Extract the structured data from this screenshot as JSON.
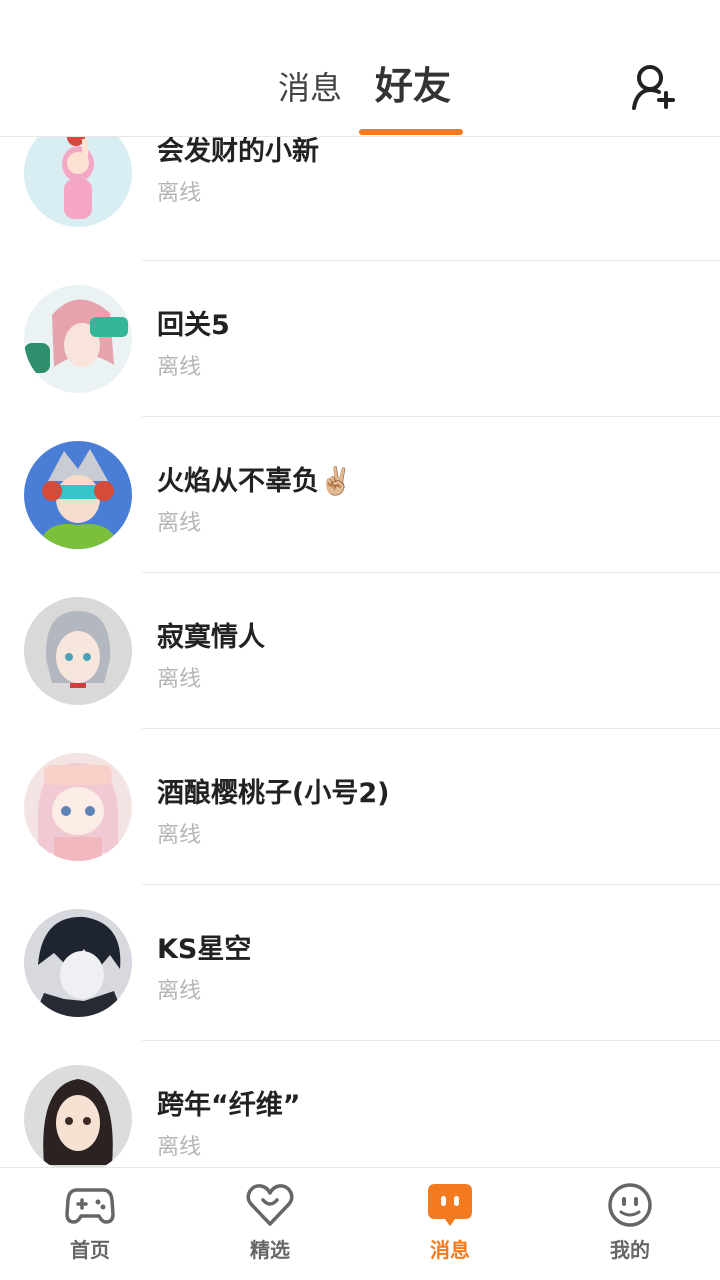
{
  "header": {
    "tabs": [
      {
        "label": "消息",
        "active": false
      },
      {
        "label": "好友",
        "active": true
      }
    ],
    "add_friend_icon": "add-user-icon"
  },
  "friends": [
    {
      "name": "会发财的小新",
      "status": "离线"
    },
    {
      "name": "回关5",
      "status": "离线"
    },
    {
      "name": "火焰从不辜负✌🏼",
      "status": "离线"
    },
    {
      "name": "寂寞情人",
      "status": "离线"
    },
    {
      "name": "酒酿樱桃子(小号2)",
      "status": "离线"
    },
    {
      "name": "KS星空",
      "status": "离线"
    },
    {
      "name": "跨年“纤维”",
      "status": "离线"
    }
  ],
  "bottom_nav": [
    {
      "label": "首页",
      "icon": "gamepad-icon",
      "active": false
    },
    {
      "label": "精选",
      "icon": "heart-icon",
      "active": false
    },
    {
      "label": "消息",
      "icon": "chat-bubble-icon",
      "active": true
    },
    {
      "label": "我的",
      "icon": "smiley-face-icon",
      "active": false
    }
  ],
  "colors": {
    "accent": "#f47a1f",
    "status_text": "#b5b5b5",
    "inactive_nav": "#666666"
  }
}
